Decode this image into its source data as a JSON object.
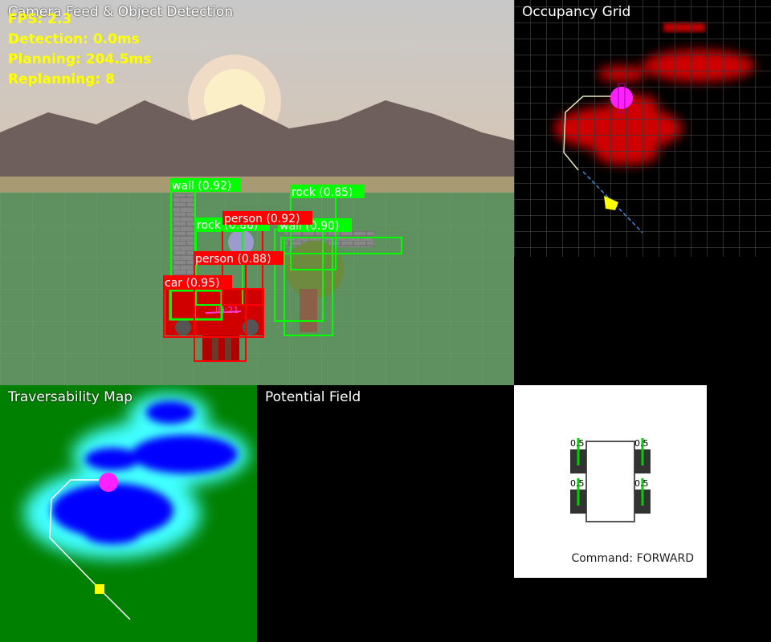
{
  "camera": {
    "title": "Camera Feed & Object Detection",
    "stats": {
      "fps": "FPS: 2.3",
      "detection": "Detection: 0.0ms",
      "planning": "Planning: 204.5ms",
      "replanning": "Replanning: 8"
    },
    "detections": [
      {
        "label": "wall (0.92)",
        "kind": "wall"
      },
      {
        "label": "rock (0.85)",
        "kind": "rock"
      },
      {
        "label": "person (0.92)",
        "kind": "person"
      },
      {
        "label": "rock (0.88)",
        "kind": "rock"
      },
      {
        "label": "wall (0.90)",
        "kind": "wall"
      },
      {
        "label": "person (0.88)",
        "kind": "person"
      },
      {
        "label": "car (0.95)",
        "kind": "car"
      }
    ],
    "colors": {
      "sky": "#c8c8c0",
      "mountains": "#6e5e5c",
      "ground": "#5e9060",
      "obstacle": "#00ff00",
      "dynamic": "#ff0000"
    }
  },
  "occupancy": {
    "title": "Occupancy Grid"
  },
  "traversability": {
    "title": "Traversability Map"
  },
  "potential": {
    "title": "Potential Field"
  },
  "robot": {
    "wheel_values": [
      "0.5",
      "0.5",
      "0.5",
      "0.5"
    ],
    "command": "Command: FORWARD"
  }
}
